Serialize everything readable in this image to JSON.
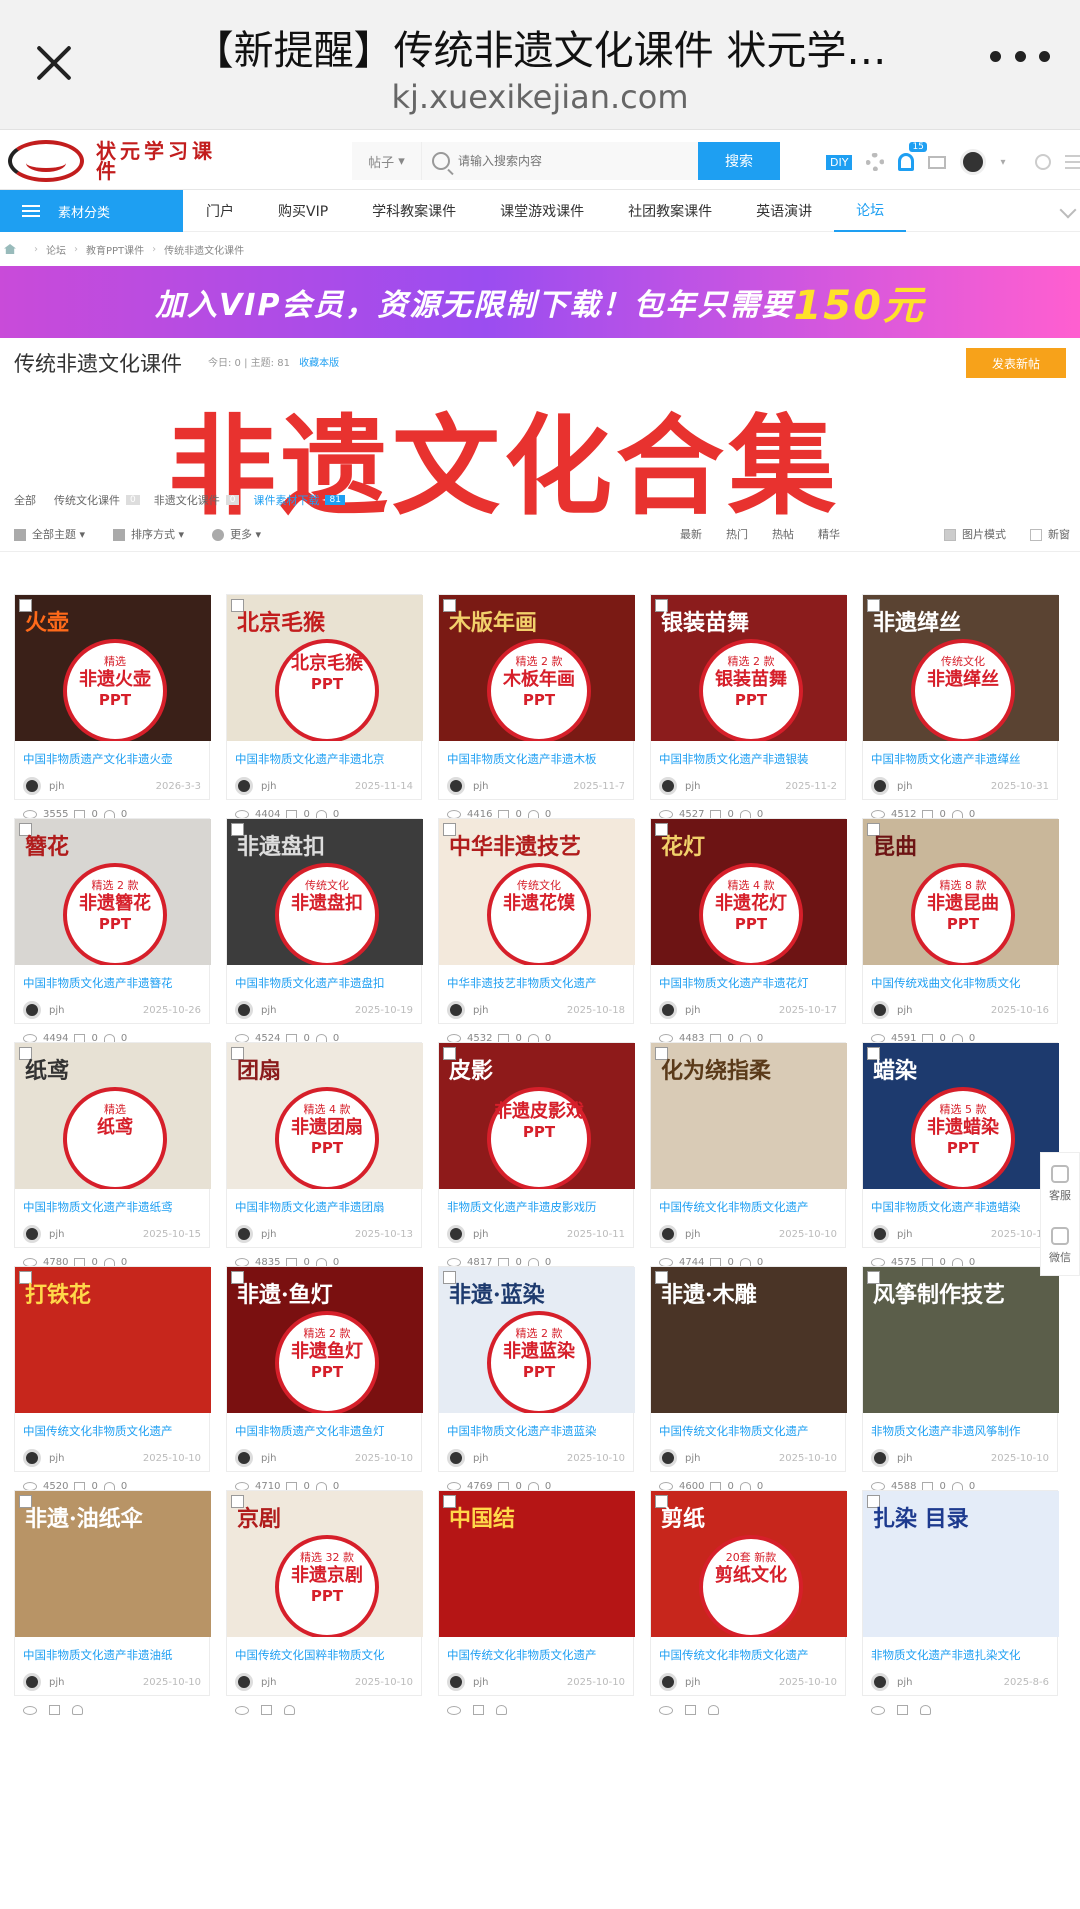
{
  "browser": {
    "title": "【新提醒】传统非遗文化课件 状元学…",
    "url": "kj.xuexikejian.com"
  },
  "site": {
    "logo_text": "状元学习课件",
    "search_type": "帖子",
    "search_placeholder": "请输入搜索内容",
    "search_button": "搜索",
    "diy": "DIY",
    "notif_count": "15"
  },
  "nav": {
    "category": "素材分类",
    "items": [
      "门户",
      "购买VIP",
      "学科教案课件",
      "课堂游戏课件",
      "社团教案课件",
      "英语演讲",
      "论坛"
    ]
  },
  "breadcrumb": [
    "论坛",
    "教育PPT课件",
    "传统非遗文化课件"
  ],
  "banner": {
    "text": "加入VIP会员，资源无限制下载！包年只需要",
    "price": "150元"
  },
  "forum": {
    "title": "传统非遗文化课件",
    "today": "今日: 0",
    "topics": "主题: 81",
    "favorite": "收藏本版",
    "post_button": "发表新帖",
    "overlay": "非遗文化合集",
    "tabs": [
      {
        "label": "全部",
        "count": ""
      },
      {
        "label": "传统文化课件",
        "count": "0"
      },
      {
        "label": "非遗文化课件",
        "count": "0"
      },
      {
        "label": "课件素材下载",
        "count": "81"
      }
    ]
  },
  "filters": {
    "left": [
      "全部主题",
      "排序方式",
      "更多"
    ],
    "right": [
      "最新",
      "热门",
      "热帖",
      "精华"
    ],
    "image_mode": "图片模式",
    "new_window": "新窗"
  },
  "side_float": [
    "客服",
    "微信"
  ],
  "cards": [
    {
      "thumb_top": "精选",
      "thumb_main": "非遗火壶",
      "thumb_sub": "PPT",
      "bg": "#3a2018",
      "deco": "火壶",
      "deco_color": "#ff6a1a",
      "title": "中国非物质遗产文化非遗火壶",
      "author": "pjh",
      "date": "2026-3-3",
      "views": "3555",
      "comments": "0",
      "likes": "0"
    },
    {
      "thumb_top": "",
      "thumb_main": "北京毛猴",
      "thumb_sub": "PPT",
      "bg": "#e9e2d2",
      "deco": "北京毛猴",
      "deco_color": "#c21d1d",
      "title": "中国非物质文化遗产非遗北京",
      "author": "pjh",
      "date": "2025-11-14",
      "views": "4404",
      "comments": "0",
      "likes": "0"
    },
    {
      "thumb_top": "精选 2 款",
      "thumb_main": "木板年画",
      "thumb_sub": "PPT",
      "bg": "#7a1a14",
      "deco": "木版年画",
      "deco_color": "#f2d16b",
      "title": "中国非物质文化遗产非遗木板",
      "author": "pjh",
      "date": "2025-11-7",
      "views": "4416",
      "comments": "0",
      "likes": "0"
    },
    {
      "thumb_top": "精选 2 款",
      "thumb_main": "银装苗舞",
      "thumb_sub": "PPT",
      "bg": "#8b1c1c",
      "deco": "银装苗舞",
      "deco_color": "#fff",
      "title": "中国非物质文化遗产非遗银装",
      "author": "pjh",
      "date": "2025-11-2",
      "views": "4527",
      "comments": "0",
      "likes": "0"
    },
    {
      "thumb_top": "传统文化",
      "thumb_main": "非遗缂丝",
      "thumb_sub": "",
      "bg": "#5a4332",
      "deco": "非遗缂丝",
      "deco_color": "#fff",
      "title": "中国非物质文化遗产非遗缂丝",
      "author": "pjh",
      "date": "2025-10-31",
      "views": "4512",
      "comments": "0",
      "likes": "0"
    },
    {
      "thumb_top": "精选 2 款",
      "thumb_main": "非遗簪花",
      "thumb_sub": "PPT",
      "bg": "#d8d6d2",
      "deco": "簪花",
      "deco_color": "#b01c1c",
      "title": "中国非物质文化遗产非遗簪花",
      "author": "pjh",
      "date": "2025-10-26",
      "views": "4494",
      "comments": "0",
      "likes": "0"
    },
    {
      "thumb_top": "传统文化",
      "thumb_main": "非遗盘扣",
      "thumb_sub": "",
      "bg": "#3c3c3c",
      "deco": "非遗盘扣",
      "deco_color": "#ddd",
      "title": "中国非物质文化遗产非遗盘扣",
      "author": "pjh",
      "date": "2025-10-19",
      "views": "4524",
      "comments": "0",
      "likes": "0"
    },
    {
      "thumb_top": "传统文化",
      "thumb_main": "非遗花馍",
      "thumb_sub": "",
      "bg": "#f3e9dc",
      "deco": "中华非遗技艺",
      "deco_color": "#b01c1c",
      "title": "中华非遗技艺非物质文化遗产",
      "author": "pjh",
      "date": "2025-10-18",
      "views": "4532",
      "comments": "0",
      "likes": "0"
    },
    {
      "thumb_top": "精选 4 款",
      "thumb_main": "非遗花灯",
      "thumb_sub": "PPT",
      "bg": "#6d1414",
      "deco": "花灯",
      "deco_color": "#f2d16b",
      "title": "中国非物质文化遗产非遗花灯",
      "author": "pjh",
      "date": "2025-10-17",
      "views": "4483",
      "comments": "0",
      "likes": "0"
    },
    {
      "thumb_top": "精选 8 款",
      "thumb_main": "非遗昆曲",
      "thumb_sub": "PPT",
      "bg": "#c9b79a",
      "deco": "昆曲",
      "deco_color": "#6d1414",
      "title": "中国传统戏曲文化非物质文化",
      "author": "pjh",
      "date": "2025-10-16",
      "views": "4591",
      "comments": "0",
      "likes": "0"
    },
    {
      "thumb_top": "精选",
      "thumb_main": "纸鸢",
      "thumb_sub": "",
      "bg": "#e7e1d4",
      "deco": "纸鸢",
      "deco_color": "#333",
      "title": "中国非物质文化遗产非遗纸鸢",
      "author": "pjh",
      "date": "2025-10-15",
      "views": "4780",
      "comments": "0",
      "likes": "0"
    },
    {
      "thumb_top": "精选 4 款",
      "thumb_main": "非遗团扇",
      "thumb_sub": "PPT",
      "bg": "#efe9df",
      "deco": "团扇",
      "deco_color": "#8b1c1c",
      "title": "中国非物质文化遗产非遗团扇",
      "author": "pjh",
      "date": "2025-10-13",
      "views": "4835",
      "comments": "0",
      "likes": "0"
    },
    {
      "thumb_top": "",
      "thumb_main": "非遗皮影戏",
      "thumb_sub": "PPT",
      "bg": "#8e1a1a",
      "deco": "皮影",
      "deco_color": "#fff",
      "title": "非物质文化遗产非遗皮影戏历",
      "author": "pjh",
      "date": "2025-10-11",
      "views": "4817",
      "comments": "0",
      "likes": "0"
    },
    {
      "thumb_top": "",
      "thumb_main": "",
      "thumb_sub": "",
      "bg": "#d9cbb6",
      "deco": "化为绕指柔",
      "deco_color": "#5a3a1a",
      "title": "中国传统文化非物质文化遗产",
      "author": "pjh",
      "date": "2025-10-10",
      "views": "4744",
      "comments": "0",
      "likes": "0"
    },
    {
      "thumb_top": "精选 5 款",
      "thumb_main": "非遗蜡染",
      "thumb_sub": "PPT",
      "bg": "#1d3a6e",
      "deco": "蜡染",
      "deco_color": "#fff",
      "title": "中国非物质文化遗产非遗蜡染",
      "author": "pjh",
      "date": "2025-10-10",
      "views": "4575",
      "comments": "0",
      "likes": "0"
    },
    {
      "thumb_top": "",
      "thumb_main": "",
      "thumb_sub": "",
      "bg": "#c7261c",
      "deco": "打铁花",
      "deco_color": "#ffd84a",
      "title": "中国传统文化非物质文化遗产",
      "author": "pjh",
      "date": "2025-10-10",
      "views": "4520",
      "comments": "0",
      "likes": "0"
    },
    {
      "thumb_top": "精选 2 款",
      "thumb_main": "非遗鱼灯",
      "thumb_sub": "PPT",
      "bg": "#7a1010",
      "deco": "非遗·鱼灯",
      "deco_color": "#fff",
      "title": "中国非物质遗产文化非遗鱼灯",
      "author": "pjh",
      "date": "2025-10-10",
      "views": "4710",
      "comments": "0",
      "likes": "0"
    },
    {
      "thumb_top": "精选 2 款",
      "thumb_main": "非遗蓝染",
      "thumb_sub": "PPT",
      "bg": "#e6ecf4",
      "deco": "非遗·蓝染",
      "deco_color": "#1d3a6e",
      "title": "中国非物质文化遗产非遗蓝染",
      "author": "pjh",
      "date": "2025-10-10",
      "views": "4769",
      "comments": "0",
      "likes": "0"
    },
    {
      "thumb_top": "",
      "thumb_main": "",
      "thumb_sub": "",
      "bg": "#4a3426",
      "deco": "非遗·木雕",
      "deco_color": "#fff",
      "title": "中国传统文化非物质文化遗产",
      "author": "pjh",
      "date": "2025-10-10",
      "views": "4600",
      "comments": "0",
      "likes": "0"
    },
    {
      "thumb_top": "",
      "thumb_main": "",
      "thumb_sub": "",
      "bg": "#5b5e4a",
      "deco": "风筝制作技艺",
      "deco_color": "#fff",
      "title": "非物质文化遗产非遗风筝制作",
      "author": "pjh",
      "date": "2025-10-10",
      "views": "4588",
      "comments": "0",
      "likes": "0"
    },
    {
      "thumb_top": "",
      "thumb_main": "",
      "thumb_sub": "",
      "bg": "#b89466",
      "deco": "非遗·油纸伞",
      "deco_color": "#fff",
      "title": "中国非物质文化遗产非遗油纸",
      "author": "pjh",
      "date": "2025-10-10",
      "views": "",
      "comments": "",
      "likes": ""
    },
    {
      "thumb_top": "精选 32 款",
      "thumb_main": "非遗京剧",
      "thumb_sub": "PPT",
      "bg": "#f0e8dc",
      "deco": "京剧",
      "deco_color": "#b01c1c",
      "title": "中国传统文化国粹非物质文化",
      "author": "pjh",
      "date": "2025-10-10",
      "views": "",
      "comments": "",
      "likes": ""
    },
    {
      "thumb_top": "",
      "thumb_main": "",
      "thumb_sub": "",
      "bg": "#b51515",
      "deco": "中国结",
      "deco_color": "#ffd84a",
      "title": "中国传统文化非物质文化遗产",
      "author": "pjh",
      "date": "2025-10-10",
      "views": "",
      "comments": "",
      "likes": ""
    },
    {
      "thumb_top": "20套 新款",
      "thumb_main": "剪纸文化",
      "thumb_sub": "",
      "bg": "#c7261c",
      "deco": "剪纸",
      "deco_color": "#fff",
      "title": "中国传统文化非物质文化遗产",
      "author": "pjh",
      "date": "2025-10-10",
      "views": "",
      "comments": "",
      "likes": ""
    },
    {
      "thumb_top": "",
      "thumb_main": "",
      "thumb_sub": "",
      "bg": "#e4ecf8",
      "deco": "扎染 目录",
      "deco_color": "#1d3a8e",
      "title": "非物质文化遗产非遗扎染文化",
      "author": "pjh",
      "date": "2025-8-6",
      "views": "",
      "comments": "",
      "likes": ""
    }
  ]
}
